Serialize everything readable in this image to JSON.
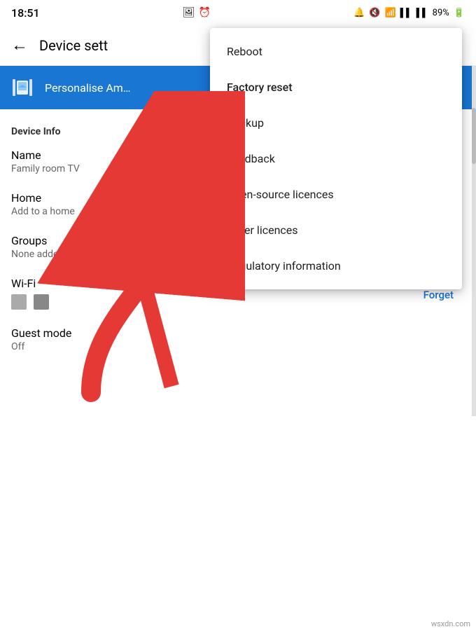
{
  "statusBar": {
    "time": "18:51",
    "centerIcons": [
      "🖼",
      "⏰"
    ],
    "rightIcons": [
      "🔕",
      "🔇",
      "📶",
      "📶",
      "89%",
      "🔋"
    ]
  },
  "appBar": {
    "backLabel": "←",
    "title": "Device sett"
  },
  "selectedItem": {
    "label": "Personalise Am…"
  },
  "deviceInfo": {
    "sectionTitle": "Device Info",
    "name": {
      "label": "Name",
      "value": "Family room TV"
    },
    "home": {
      "label": "Home",
      "value": "Add to a home"
    },
    "groups": {
      "label": "Groups",
      "value": "None added"
    },
    "wifi": {
      "label": "Wi-Fi",
      "forgetLabel": "Forget"
    },
    "guestMode": {
      "label": "Guest mode",
      "value": "Off"
    }
  },
  "dropdown": {
    "items": [
      {
        "id": "reboot",
        "label": "Reboot"
      },
      {
        "id": "factory-reset",
        "label": "Factory reset"
      },
      {
        "id": "backup",
        "label": "Backup"
      },
      {
        "id": "feedback",
        "label": "Feedback"
      },
      {
        "id": "open-source",
        "label": "Open-source licences"
      },
      {
        "id": "other-licences",
        "label": "Other licences"
      },
      {
        "id": "regulatory",
        "label": "Regulatory information"
      }
    ]
  },
  "watermark": "wsxdn.com"
}
